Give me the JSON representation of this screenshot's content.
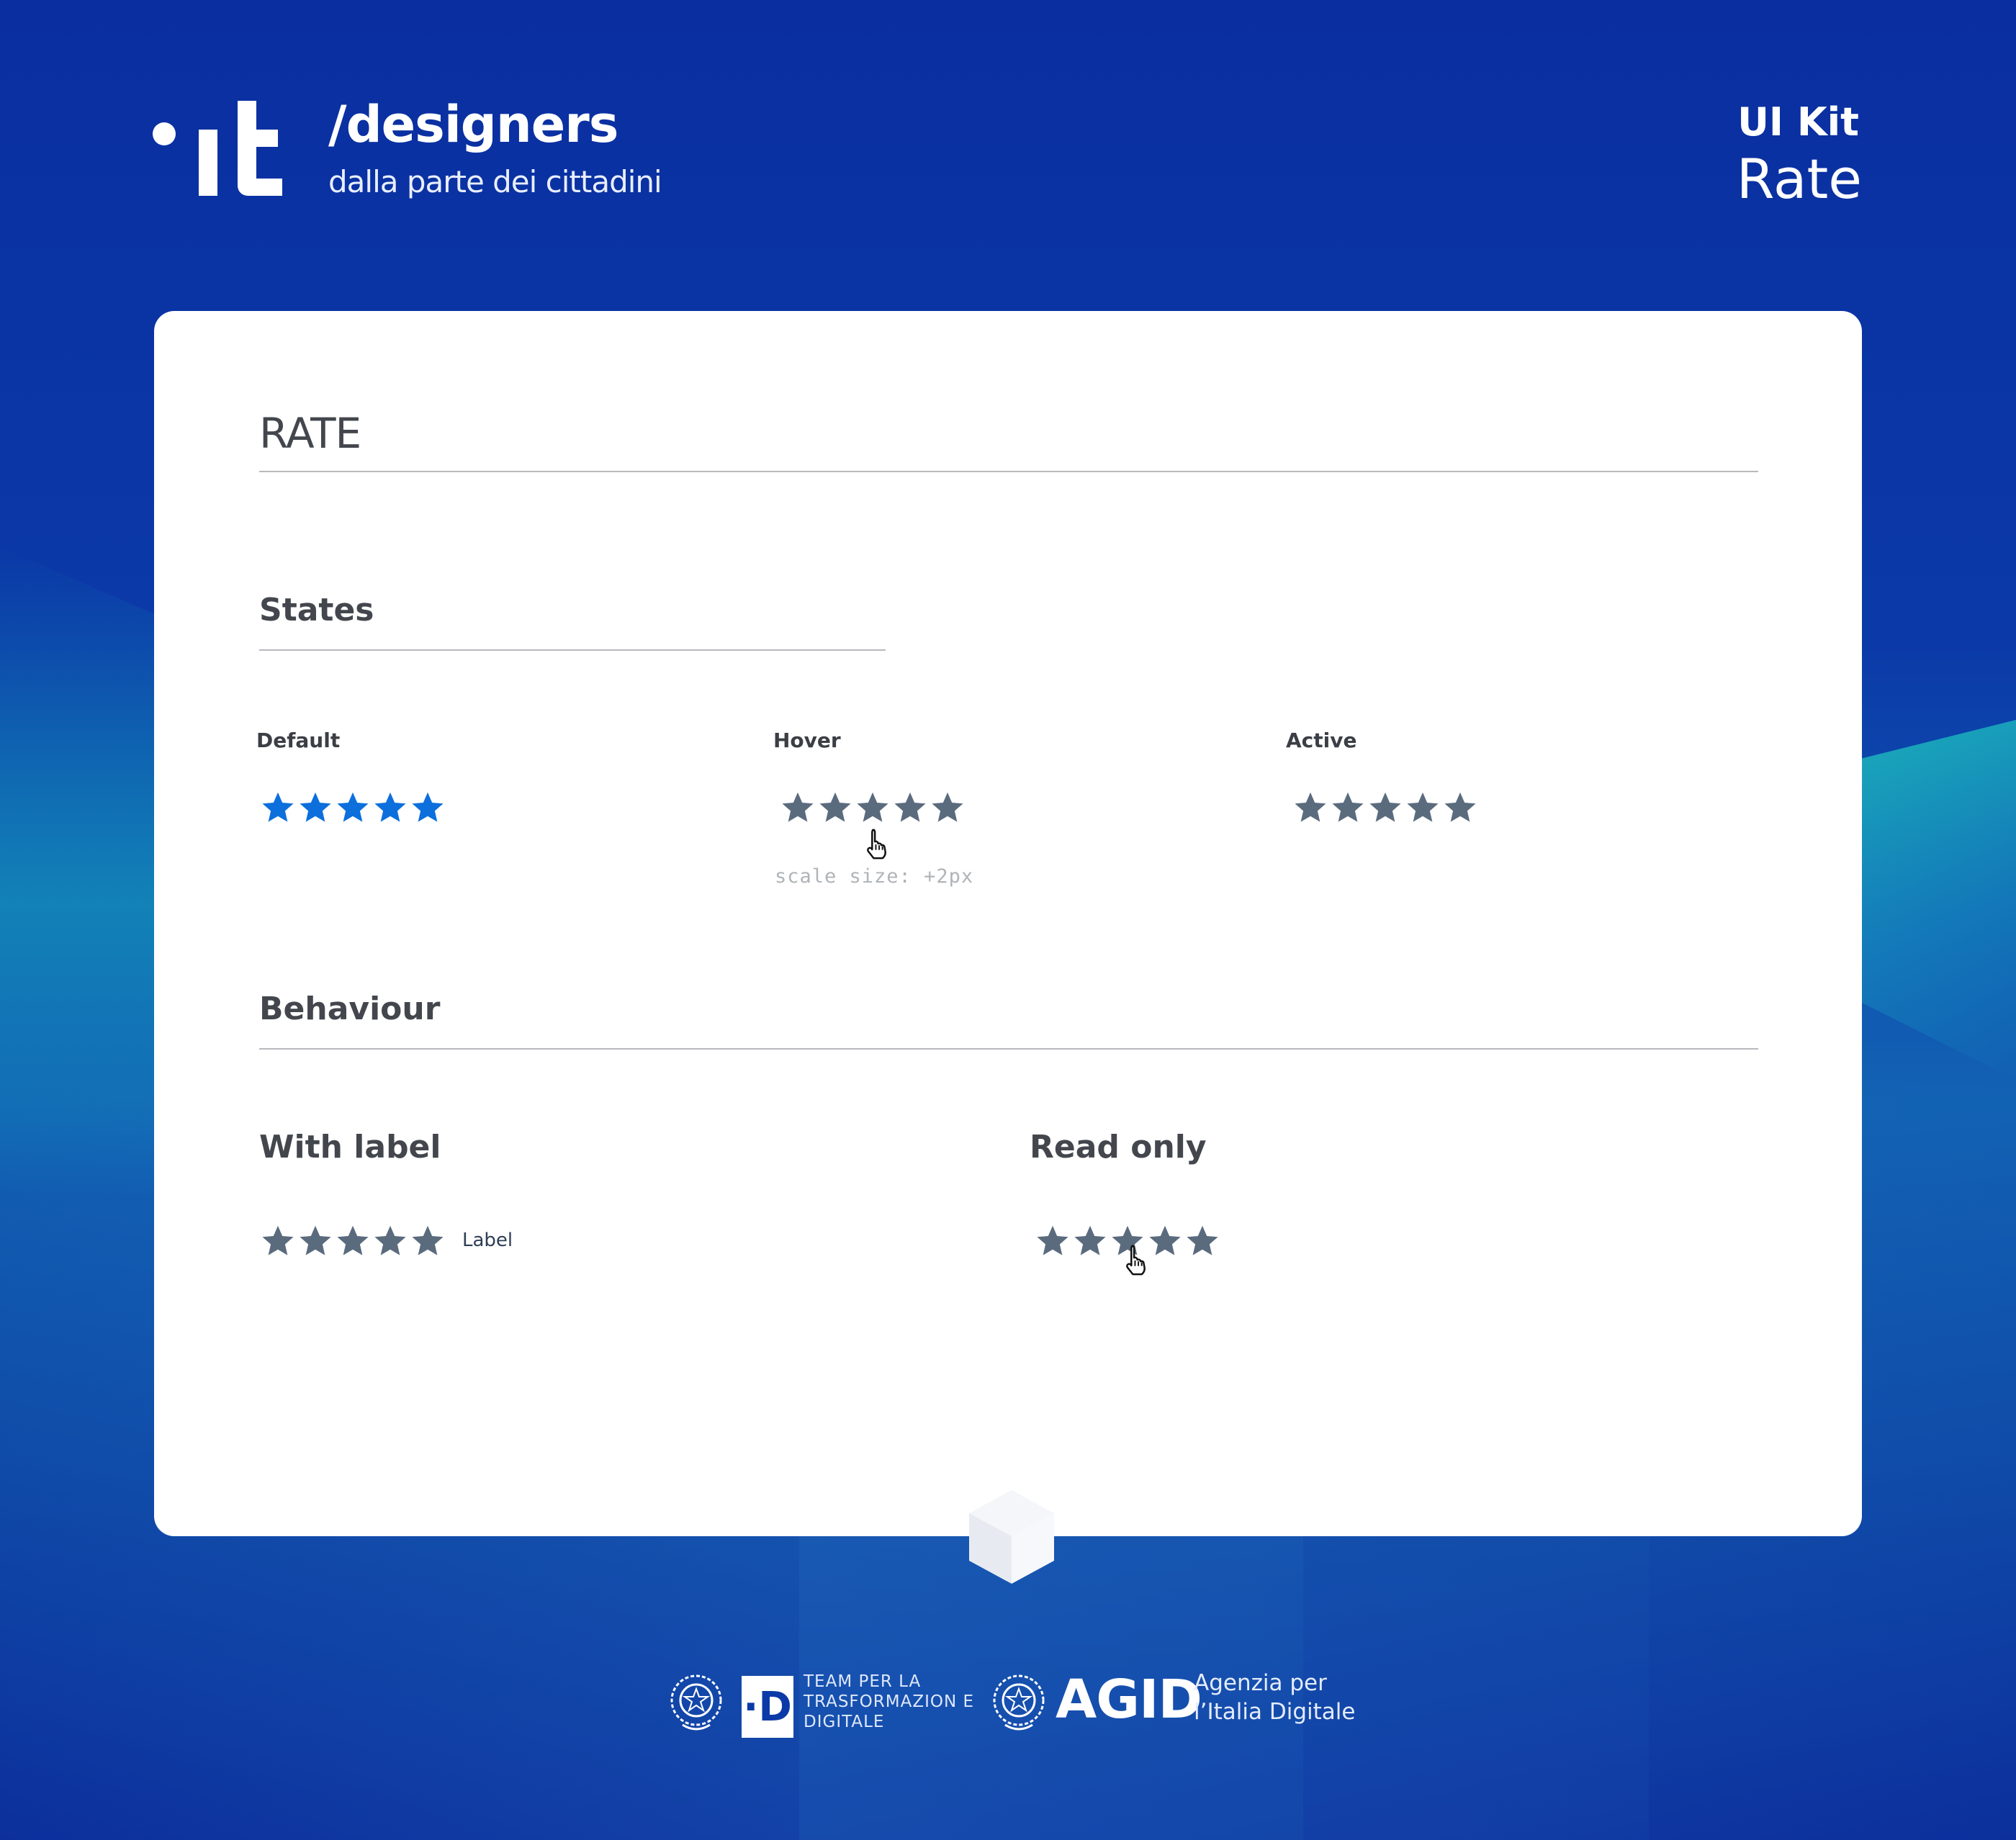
{
  "header": {
    "brand_title": "/designers",
    "brand_subtitle": "dalla parte dei cittadini",
    "kit_label": "UI Kit",
    "kit_name": "Rate"
  },
  "card": {
    "title": "RATE",
    "states": {
      "heading": "States",
      "default_label": "Default",
      "hover_label": "Hover",
      "hover_note": "scale size: +2px",
      "active_label": "Active"
    },
    "behaviour": {
      "heading": "Behaviour",
      "with_label_heading": "With label",
      "with_label_text": "Label",
      "read_only_heading": "Read only"
    }
  },
  "rating": {
    "stars_total": 5
  },
  "colors": {
    "star_blue": "#0c6fdc",
    "star_gray": "#5b6b7e",
    "background": "#0b3aa8",
    "card": "#ffffff"
  },
  "icons": [
    "it-logo",
    "star-icon",
    "pointer-cursor-icon",
    "cube-icon",
    "repubblica-emblem-icon",
    "d-logo-icon"
  ],
  "footer": {
    "team_text": "TEAM PER LA TRASFORMAZION E DIGITALE",
    "agid_acronym": "AGID",
    "agid_text": "Agenzia per l’Italia Digitale"
  }
}
